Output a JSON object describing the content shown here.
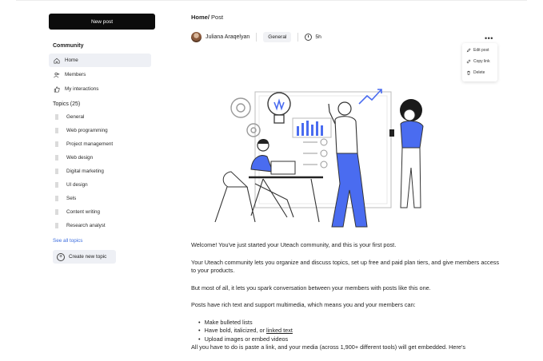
{
  "sidebar": {
    "new_post_label": "New post",
    "community_title": "Community",
    "nav": [
      {
        "label": "Home",
        "icon": "home-icon",
        "active": true
      },
      {
        "label": "Members",
        "icon": "members-icon"
      },
      {
        "label": "My interactions",
        "icon": "interactions-icon"
      }
    ],
    "topics_title": "Topics (25)",
    "topics": [
      "General",
      "Web programming",
      "Project management",
      "Web design",
      "Digital marketing",
      "UI design",
      "Sels",
      "Content writing",
      "Research analyst"
    ],
    "see_all": "See all topics",
    "create_topic": "Create new topic"
  },
  "post": {
    "breadcrumb_home": "Home/",
    "breadcrumb_current": "Post",
    "author": "Juliana Araqelyan",
    "tag": "General",
    "time": "5h",
    "more_icon": "more-dots-icon",
    "menu": [
      "Edit post",
      "Copy link",
      "Delete"
    ],
    "intro": "Welcome! You've just started your Uteach community, and this is your first post.",
    "para2": "Your Uteach community lets you organize and discuss topics, set up free and paid plan tiers, and give members access to your products.",
    "para3": "But most of all, it lets you spark conversation between your members with posts like this one.",
    "para4": "Posts have rich text and support multimedia, which means you and your members can:",
    "bullet1": "Make bulleted lists",
    "bullet2_prefix": "Have bold, italicized, or ",
    "bullet2_link": "linked text",
    "bullet3": "Upload images or embed videos",
    "para5": "All you have to do is paste a link, and your media (across 1,900+ different tools) will get embedded. Here's"
  },
  "colors": {
    "accent_blue": "#4a6cf0",
    "sidebar_active_bg": "#eef0f5",
    "button_dark": "#0c0c0c"
  }
}
